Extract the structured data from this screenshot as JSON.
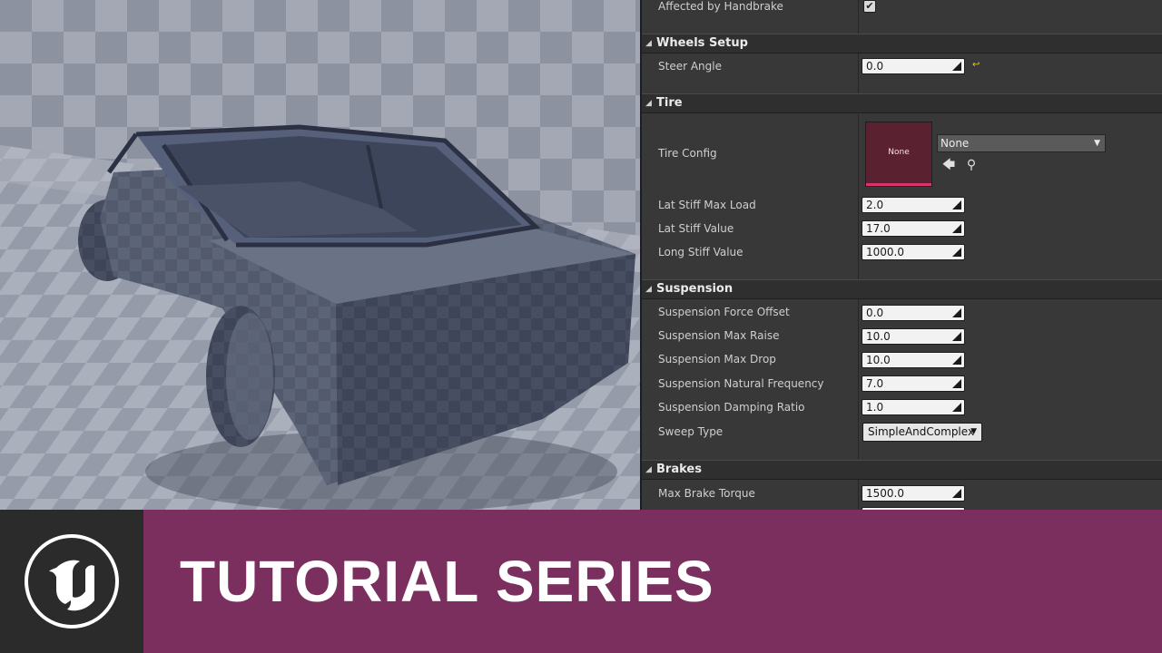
{
  "details": {
    "top_row": {
      "label": "Affected by Handbrake",
      "checked": true
    },
    "sections": {
      "wheels_setup": {
        "title": "Wheels Setup",
        "steer_angle": {
          "label": "Steer Angle",
          "value": "0.0"
        }
      },
      "tire": {
        "title": "Tire",
        "tire_config": {
          "label": "Tire Config",
          "thumbnail_text": "None",
          "selected": "None"
        },
        "lat_stiff_max_load": {
          "label": "Lat Stiff Max Load",
          "value": "2.0"
        },
        "lat_stiff_value": {
          "label": "Lat Stiff Value",
          "value": "17.0"
        },
        "long_stiff_value": {
          "label": "Long Stiff Value",
          "value": "1000.0"
        }
      },
      "suspension": {
        "title": "Suspension",
        "force_offset": {
          "label": "Suspension Force Offset",
          "value": "0.0"
        },
        "max_raise": {
          "label": "Suspension Max Raise",
          "value": "10.0"
        },
        "max_drop": {
          "label": "Suspension Max Drop",
          "value": "10.0"
        },
        "natural_frequency": {
          "label": "Suspension Natural Frequency",
          "value": "7.0"
        },
        "damping_ratio": {
          "label": "Suspension Damping Ratio",
          "value": "1.0"
        },
        "sweep_type": {
          "label": "Sweep Type",
          "value": "SimpleAndComplex"
        }
      },
      "brakes": {
        "title": "Brakes",
        "max_brake_torque": {
          "label": "Max Brake Torque",
          "value": "1500.0"
        }
      }
    }
  },
  "banner": {
    "title": "TUTORIAL SERIES",
    "background_color": "#7b2f5e",
    "logo_icon": "unreal-engine-logo-icon"
  }
}
